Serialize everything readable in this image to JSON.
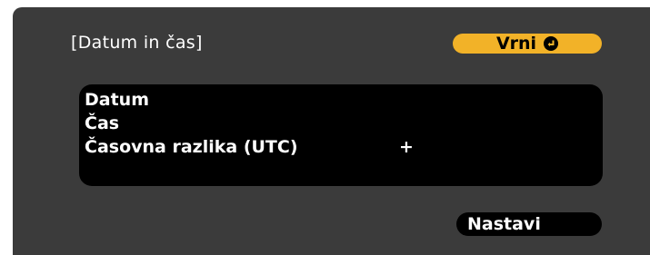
{
  "window": {
    "title": "[Datum in čas]"
  },
  "buttons": {
    "back_label": "Vrni",
    "back_icon": "enter-icon",
    "set_label": "Nastavi"
  },
  "settings": [
    {
      "label": "Datum",
      "value": ""
    },
    {
      "label": "Čas",
      "value": ""
    },
    {
      "label": "Časovna razlika (UTC)",
      "value": "+"
    },
    {
      "label": "",
      "value": ""
    }
  ],
  "colors": {
    "background": "#3b3b3b",
    "list_background": "#000000",
    "accent": "#f2b228",
    "text": "#ffffff"
  }
}
